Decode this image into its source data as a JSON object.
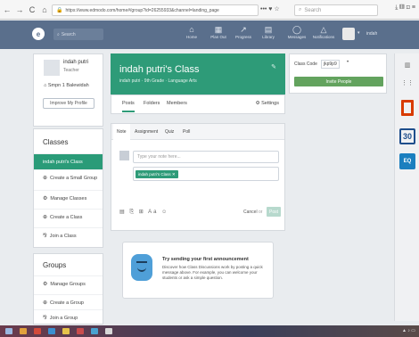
{
  "browser": {
    "back": "←",
    "forward": "→",
    "reload": "C",
    "home": "⌂",
    "url": "https://www.edmodo.com/home#/group?id=26255933&channel=landing_page",
    "url_tools": "••• ♥ ☆",
    "search_placeholder": "Search",
    "right_icons": "⤓ ▥ ⊡ ≡"
  },
  "topnav": {
    "logo": "e",
    "search_placeholder": "Search",
    "items": [
      {
        "label": "Home",
        "glyph": "⌂"
      },
      {
        "label": "Plan Out",
        "glyph": "▦"
      },
      {
        "label": "Progress",
        "glyph": "↗"
      },
      {
        "label": "Library",
        "glyph": "▤"
      },
      {
        "label": "Messages",
        "glyph": "◯"
      },
      {
        "label": "Notifications",
        "glyph": "△"
      }
    ],
    "user": "indah"
  },
  "profile": {
    "name": "indah putri",
    "role": "Teacher",
    "school": "Smpn 1 Balewidah",
    "button": "Improve My Profile"
  },
  "classes": {
    "title": "Classes",
    "items": [
      {
        "label": "indah putri's Class",
        "icon": "",
        "active": true
      },
      {
        "label": "Create a Small Group",
        "icon": "⊕",
        "active": false
      },
      {
        "label": "Manage Classes",
        "icon": "⚙",
        "active": false
      },
      {
        "label": "Create a Class",
        "icon": "⊕",
        "active": false
      },
      {
        "label": "Join a Class",
        "icon": "⅋",
        "active": false
      }
    ]
  },
  "groups": {
    "title": "Groups",
    "items": [
      {
        "label": "Manage Groups",
        "icon": "⚙"
      },
      {
        "label": "Create a Group",
        "icon": "⊕"
      },
      {
        "label": "Join a Group",
        "icon": "⅋"
      }
    ]
  },
  "class_header": {
    "title": "indah putri's Class",
    "subtitle": "indah putri · 9th Grade · Language Arts",
    "edit_icon": "✎"
  },
  "class_tabs": {
    "posts": "Posts",
    "folders": "Folders",
    "members": "Members",
    "settings": "⚙ Settings"
  },
  "composer": {
    "tabs": [
      "Note",
      "Assignment",
      "Quiz",
      "Poll"
    ],
    "placeholder": "Type your note here...",
    "recipient_chip": "indah putri's Class ✕",
    "tools": "▤ ⎘ ⊞ Aa ☺",
    "cancel": "Cancel",
    "or": "or",
    "post": "Post"
  },
  "announcement": {
    "title": "Try sending your first announcement",
    "body": "Discover how Class Discussions work by posting a quick message above. For example, you can welcome your students or ask a simple question."
  },
  "class_code": {
    "label": "Class Code",
    "value": "jkp9p9",
    "menu": "•",
    "invite": "Invite People"
  },
  "dock": {
    "top1": "▥",
    "top2": "⋮⋮",
    "calendar_num": "30",
    "quiz_label": "EQ"
  },
  "colors": {
    "brand_green": "#2e9b78",
    "nav_blue": "#5a6f8c",
    "invite_green": "#63a35e"
  }
}
